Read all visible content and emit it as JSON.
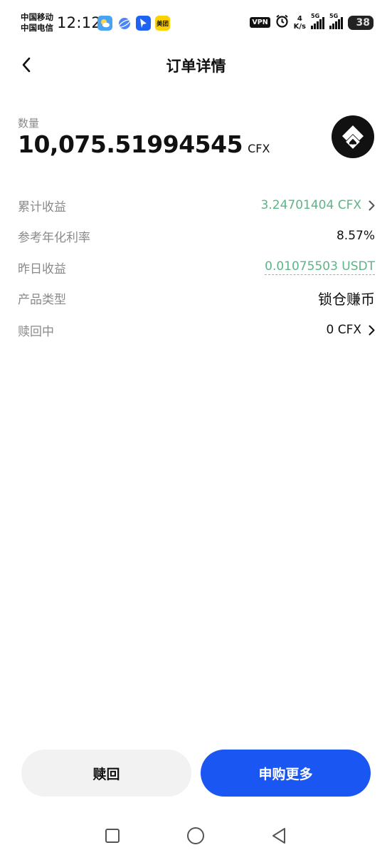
{
  "status_bar": {
    "carrier_1": "中国移动",
    "carrier_2": "中国电信",
    "time": "12:12",
    "apps": [
      {
        "icon": "weather-icon",
        "color": "#4aa3f0"
      },
      {
        "icon": "browser-icon",
        "color": "#3b82f6"
      },
      {
        "icon": "feishu-icon",
        "color": "#1e63f2"
      },
      {
        "icon": "meituan-icon",
        "color": "#ffd100",
        "label": "美团"
      }
    ],
    "vpn": "VPN",
    "net_speed_value": "4",
    "net_speed_unit": "K/s",
    "signal_1_label": "5G",
    "signal_2_label": "5G",
    "battery": "38"
  },
  "header": {
    "title": "订单详情",
    "back_icon": "chevron-left-icon"
  },
  "summary": {
    "quantity_label": "数量",
    "quantity_value": "10,075.51994545",
    "quantity_unit": "CFX",
    "coin_icon": "conflux-logo-icon"
  },
  "details": [
    {
      "key": "累计收益",
      "value": "3.24701404 CFX",
      "color": "#5cb587",
      "chevron": true
    },
    {
      "key": "参考年化利率",
      "value": "8.57%"
    },
    {
      "key": "昨日收益",
      "value": "0.01075503 USDT",
      "color": "#5cb587",
      "dotted": true
    },
    {
      "key": "产品类型",
      "value": "锁仓赚币"
    },
    {
      "key": "赎回中",
      "value": "0 CFX",
      "chevron": true
    }
  ],
  "actions": {
    "redeem_label": "赎回",
    "subscribe_more_label": "申购更多",
    "primary_color": "#1a57f2"
  },
  "nav_bar": {
    "recent_icon": "square-icon",
    "home_icon": "circle-icon",
    "back_icon": "triangle-back-icon"
  }
}
